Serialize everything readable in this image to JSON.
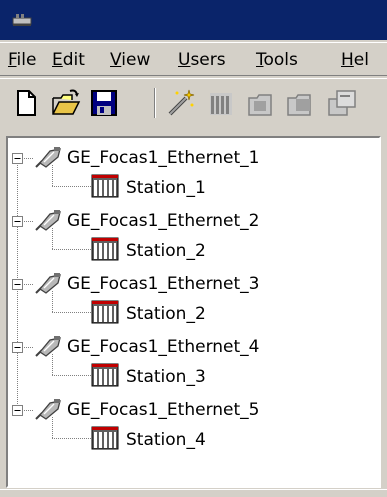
{
  "menubar": {
    "items": [
      {
        "accel": "F",
        "rest": "ile"
      },
      {
        "accel": "E",
        "rest": "dit"
      },
      {
        "accel": "V",
        "rest": "iew"
      },
      {
        "accel": "U",
        "rest": "sers"
      },
      {
        "accel": "T",
        "rest": "ools"
      },
      {
        "accel": "H",
        "rest": "el"
      }
    ]
  },
  "toolbar": {
    "buttons": [
      "new-file-icon",
      "open-folder-icon",
      "save-disk-icon",
      "wand-icon",
      "device-icon",
      "new-channel-icon",
      "new-device-icon",
      "properties-icon"
    ]
  },
  "tree": {
    "channels": [
      {
        "label": "GE_Focas1_Ethernet_1",
        "device": "Station_1"
      },
      {
        "label": "GE_Focas1_Ethernet_2",
        "device": "Station_2"
      },
      {
        "label": "GE_Focas1_Ethernet_3",
        "device": "Station_2"
      },
      {
        "label": "GE_Focas1_Ethernet_4",
        "device": "Station_3"
      },
      {
        "label": "GE_Focas1_Ethernet_5",
        "device": "Station_4"
      }
    ]
  },
  "colors": {
    "titlebar": "#0a246a",
    "window_face": "#d4d0c8",
    "tree_background": "#ffffff"
  }
}
